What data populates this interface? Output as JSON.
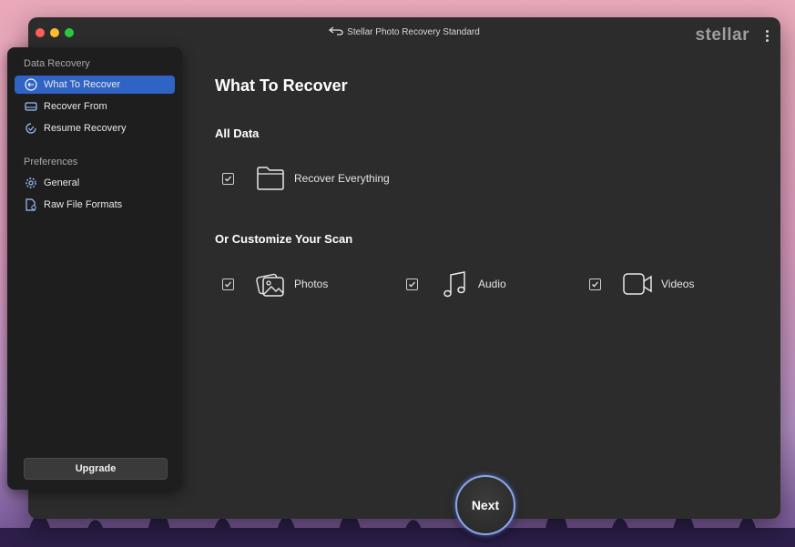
{
  "window": {
    "title": "Stellar Photo Recovery Standard",
    "brand": "stellar"
  },
  "sidebar": {
    "sections": [
      {
        "label": "Data Recovery",
        "items": [
          {
            "label": "What To Recover",
            "icon": "target-icon",
            "active": true
          },
          {
            "label": "Recover From",
            "icon": "drive-icon",
            "active": false
          },
          {
            "label": "Resume Recovery",
            "icon": "resume-icon",
            "active": false
          }
        ]
      },
      {
        "label": "Preferences",
        "items": [
          {
            "label": "General",
            "icon": "gear-icon",
            "active": false
          },
          {
            "label": "Raw File Formats",
            "icon": "file-settings-icon",
            "active": false
          }
        ]
      }
    ],
    "upgrade_label": "Upgrade"
  },
  "main": {
    "title": "What To Recover",
    "all_data": {
      "heading": "All Data",
      "option": {
        "label": "Recover Everything",
        "checked": true,
        "icon": "folder-icon"
      }
    },
    "customize": {
      "heading": "Or Customize Your Scan",
      "options": [
        {
          "label": "Photos",
          "checked": true,
          "icon": "photos-icon"
        },
        {
          "label": "Audio",
          "checked": true,
          "icon": "music-note-icon"
        },
        {
          "label": "Videos",
          "checked": true,
          "icon": "video-camera-icon"
        }
      ]
    }
  },
  "footer": {
    "next_label": "Next"
  },
  "colors": {
    "accent": "#2f63c4",
    "window_bg": "#2c2c2c",
    "sidebar_bg": "#1e1e1e",
    "next_ring": "#8ea6e8"
  }
}
